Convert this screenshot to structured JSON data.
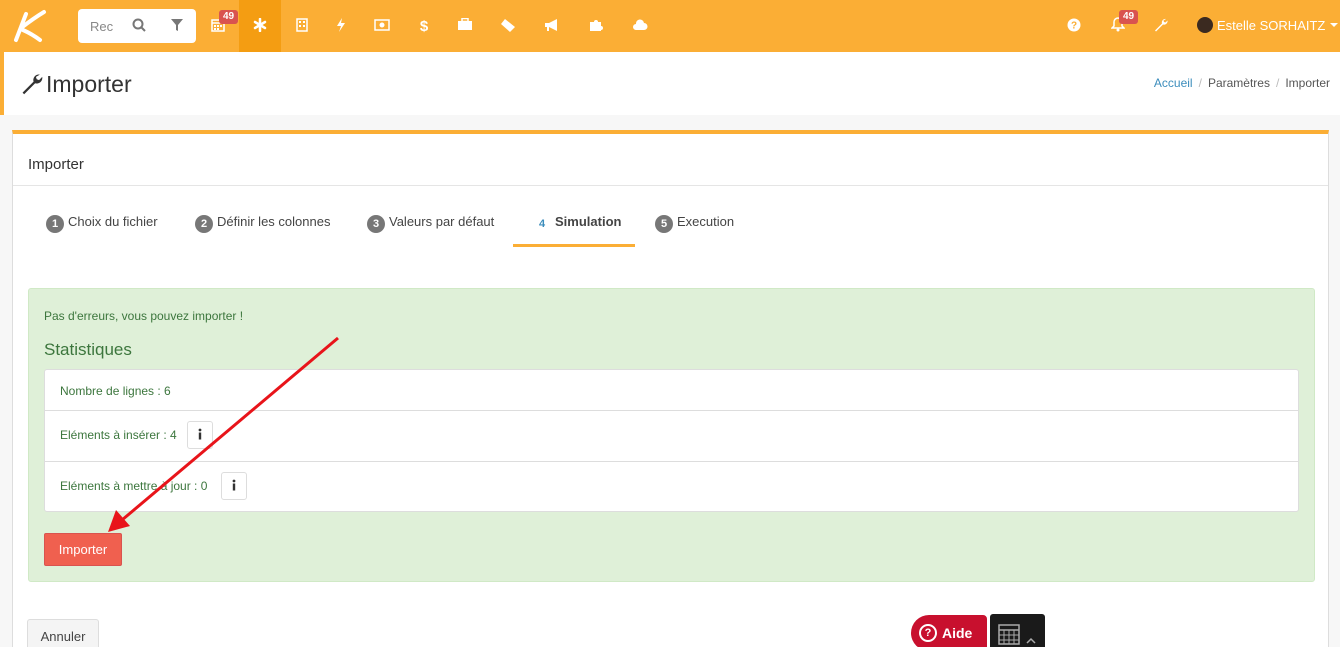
{
  "topbar": {
    "search_placeholder": "Rec",
    "badges": {
      "calendar": "49",
      "notifications": "49"
    },
    "user_name": "Estelle SORHAITZ"
  },
  "header": {
    "title": "Importer",
    "breadcrumb": [
      "Accueil",
      "Paramètres",
      "Importer"
    ]
  },
  "box": {
    "title": "Importer",
    "tabs": [
      {
        "num": "1",
        "label": "Choix du fichier"
      },
      {
        "num": "2",
        "label": "Définir les colonnes"
      },
      {
        "num": "3",
        "label": "Valeurs par défaut"
      },
      {
        "num": "4",
        "label": "Simulation"
      },
      {
        "num": "5",
        "label": "Execution"
      }
    ],
    "active_tab": "Simulation"
  },
  "result": {
    "message": "Pas d'erreurs, vous pouvez importer !",
    "heading": "Statistiques",
    "rows": [
      {
        "label": "Nombre de lignes : 6"
      },
      {
        "label": "Eléments à insérer : 4"
      },
      {
        "label": "Eléments à mettre à jour : 0"
      }
    ],
    "import_button": "Importer"
  },
  "footer": {
    "cancel_button": "Annuler",
    "help_button": "Aide"
  },
  "colors": {
    "brand": "#fbae35",
    "danger": "#f0604f",
    "success_bg": "#dff0d8",
    "help": "#c8102e"
  }
}
